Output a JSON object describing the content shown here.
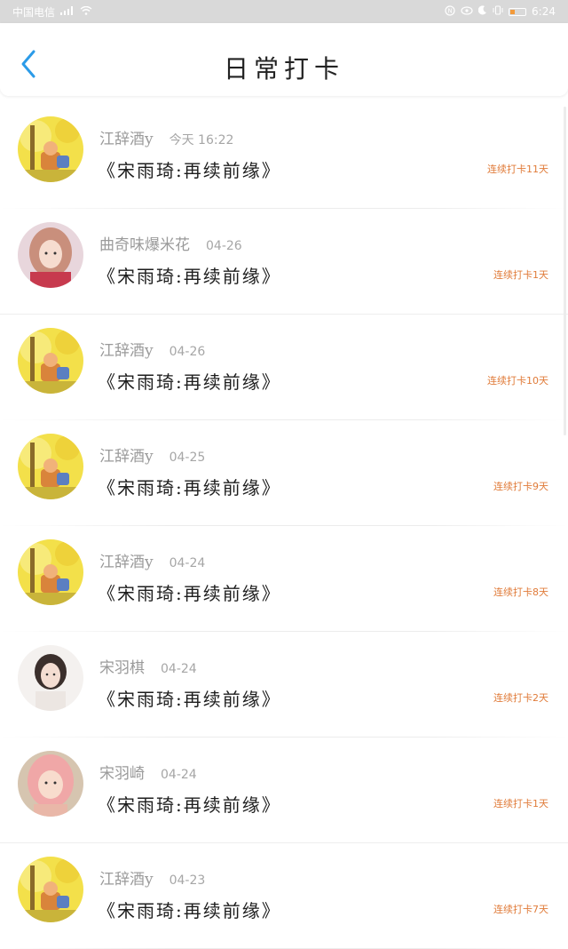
{
  "status_bar": {
    "carrier": "中国电信",
    "time": "6:24",
    "icons": [
      "signal-icon",
      "wifi-icon",
      "nfc-icon",
      "eye-icon",
      "moon-icon",
      "vibrate-icon",
      "battery-icon"
    ]
  },
  "header": {
    "title": "日常打卡",
    "back_icon": "chevron-left-icon"
  },
  "colors": {
    "accent_blue": "#2b9be8",
    "streak_orange": "#e07b39",
    "name_gray": "#9a9a9a",
    "title_dark": "#1d1d1d",
    "status_bar_bg": "#d9d9d9"
  },
  "posts": [
    {
      "name": "江辞酒y",
      "time": "今天 16:22",
      "book": "《宋雨琦:再续前缘》",
      "streak": "连续打卡11天",
      "avatar": "avatar-cartoon-yellow"
    },
    {
      "name": "曲奇味爆米花",
      "time": "04-26",
      "book": "《宋雨琦:再续前缘》",
      "streak": "连续打卡1天",
      "avatar": "avatar-photo-pink"
    },
    {
      "name": "江辞酒y",
      "time": "04-26",
      "book": "《宋雨琦:再续前缘》",
      "streak": "连续打卡10天",
      "avatar": "avatar-cartoon-yellow"
    },
    {
      "name": "江辞酒y",
      "time": "04-25",
      "book": "《宋雨琦:再续前缘》",
      "streak": "连续打卡9天",
      "avatar": "avatar-cartoon-yellow"
    },
    {
      "name": "江辞酒y",
      "time": "04-24",
      "book": "《宋雨琦:再续前缘》",
      "streak": "连续打卡8天",
      "avatar": "avatar-cartoon-yellow"
    },
    {
      "name": "宋羽棋",
      "time": "04-24",
      "book": "《宋雨琦:再续前缘》",
      "streak": "连续打卡2天",
      "avatar": "avatar-photo-light"
    },
    {
      "name": "宋羽崎",
      "time": "04-24",
      "book": "《宋雨琦:再续前缘》",
      "streak": "连续打卡1天",
      "avatar": "avatar-photo-peach"
    },
    {
      "name": "江辞酒y",
      "time": "04-23",
      "book": "《宋雨琦:再续前缘》",
      "streak": "连续打卡7天",
      "avatar": "avatar-cartoon-yellow"
    }
  ]
}
